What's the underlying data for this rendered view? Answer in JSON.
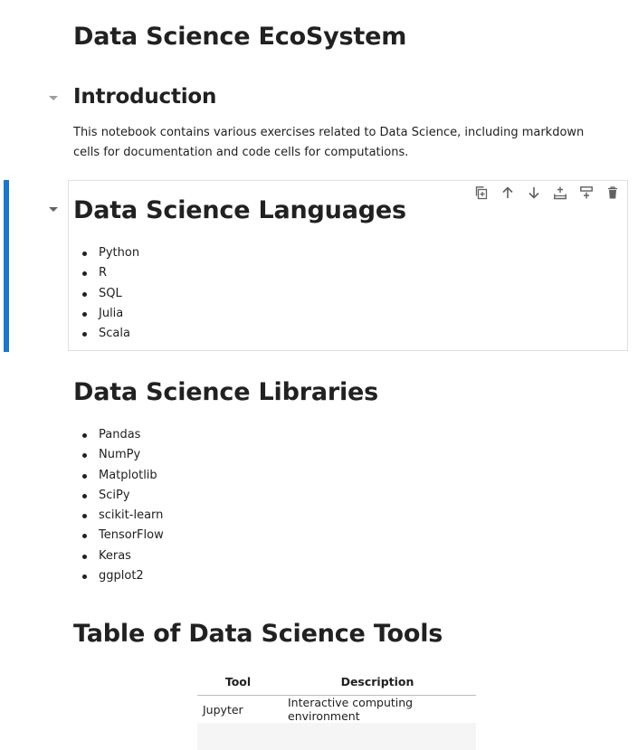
{
  "notebook": {
    "title_cell": {
      "heading": "Data Science EcoSystem"
    },
    "intro_cell": {
      "heading": "Introduction",
      "paragraph": "This notebook contains various exercises related to Data Science, including markdown cells for documentation and code cells for computations."
    },
    "languages_cell": {
      "heading": "Data Science Languages",
      "items": [
        "Python",
        "R",
        "SQL",
        "Julia",
        "Scala"
      ]
    },
    "libraries_cell": {
      "heading": "Data Science Libraries",
      "items": [
        "Pandas",
        "NumPy",
        "Matplotlib",
        "SciPy",
        "scikit-learn",
        "TensorFlow",
        "Keras",
        "ggplot2"
      ]
    },
    "tools_cell": {
      "heading": "Table of Data Science Tools",
      "columns": [
        "Tool",
        "Description"
      ],
      "rows": [
        [
          "Jupyter",
          "Interactive computing environment"
        ],
        [
          "",
          ""
        ]
      ]
    }
  },
  "cell_toolbar": {
    "icons": [
      "duplicate-cell-icon",
      "move-up-icon",
      "move-down-icon",
      "insert-cell-above-icon",
      "insert-cell-below-icon",
      "delete-cell-icon"
    ]
  },
  "colors": {
    "active_cell_bar": "#1976d2",
    "cell_border": "#e0e0e0",
    "text": "#212121"
  }
}
